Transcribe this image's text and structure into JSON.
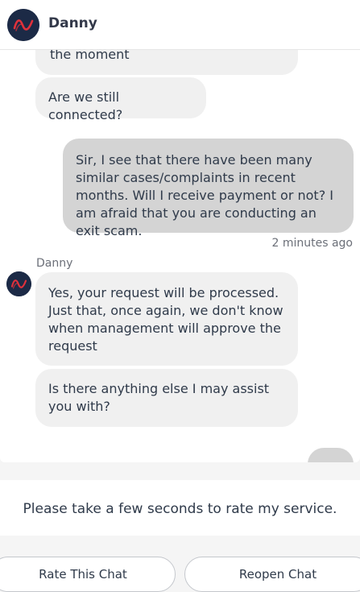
{
  "header": {
    "agent_name": "Danny"
  },
  "messages": {
    "m1_tail": "the moment",
    "m2": "Are we still connected?",
    "m3": "Sir, I see that there have been many similar cases/complaints in recent months. Will I receive payment or not? I am afraid that you are conducting an exit scam.",
    "m3_time": "2 minutes ago",
    "sender": "Danny",
    "m4": "Yes, your request will be processed. Just that, once again, we don't know when management will approve the request",
    "m5": "Is there anything else I may assist you with?"
  },
  "rating": {
    "prompt": "Please take a few seconds to rate my service.",
    "rate_button": "Rate This Chat",
    "reopen_button": "Reopen Chat"
  },
  "colors": {
    "agent_bubble": "#f0f0f0",
    "user_bubble": "#d4d4d4",
    "avatar_bg": "#1c2a46",
    "avatar_accent": "#e0313b"
  },
  "icons": {
    "avatar": "danny-logo-icon"
  }
}
